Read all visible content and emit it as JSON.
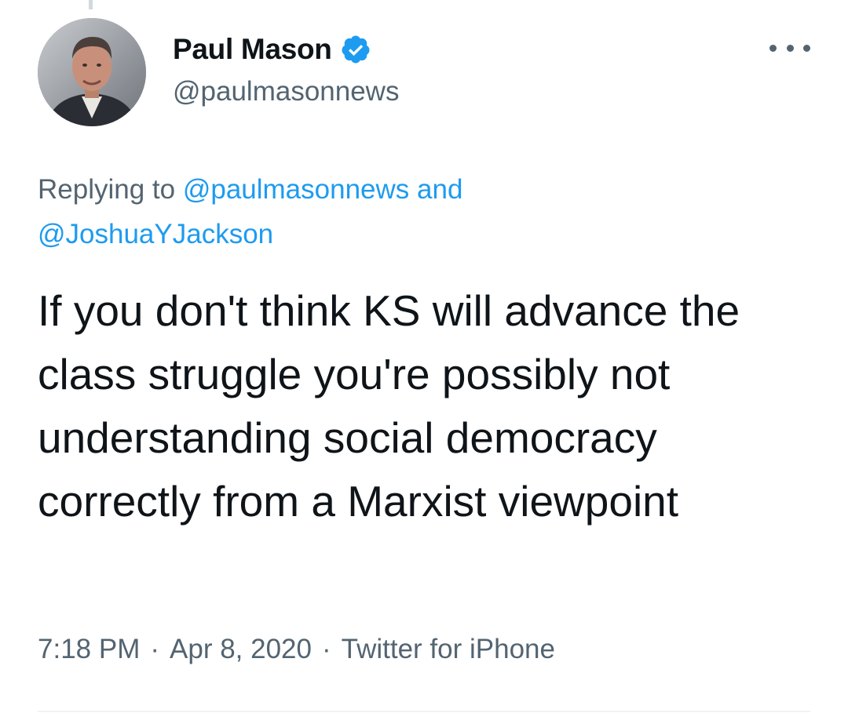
{
  "tweet": {
    "author": {
      "display_name": "Paul Mason",
      "handle": "@paulmasonnews",
      "verified": true,
      "verified_icon": "verified-badge-icon"
    },
    "more_icon": "more-options-icon",
    "replying": {
      "prefix": "Replying to ",
      "mention_1": "@paulmasonnews",
      "connector": " and ",
      "mention_2": "@JoshuaYJackson"
    },
    "text": "If you don't think KS will advance the class struggle you're possibly not understanding social democracy correctly from a Marxist viewpoint",
    "meta": {
      "time": "7:18 PM",
      "separator": "·",
      "date": "Apr 8, 2020",
      "source": "Twitter for iPhone"
    }
  },
  "colors": {
    "text_primary": "#0f1419",
    "text_secondary": "#536471",
    "accent": "#1d9bf0",
    "divider": "#eff3f4"
  }
}
